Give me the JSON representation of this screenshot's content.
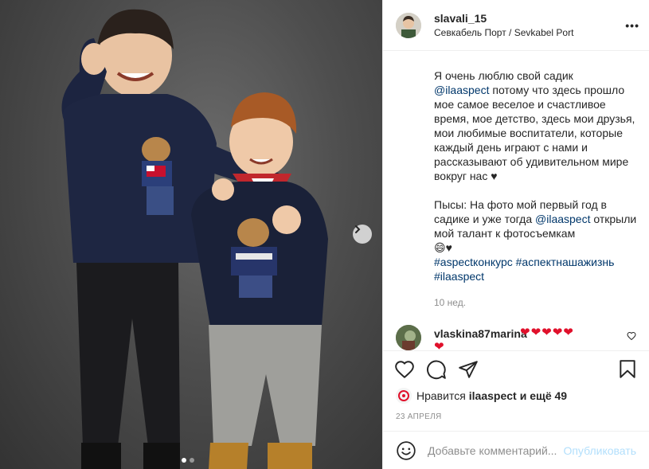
{
  "post": {
    "username": "slavali_15",
    "location": "Севкабель Порт / Sevkabel Port",
    "more_label": "•••"
  },
  "caption": {
    "line1": "Я очень люблю свой садик",
    "mention1": "@ilaaspect",
    "line2": " потому что здесь прошло мое самое веселое и счастливое время, мое детство, здесь мои друзья, мои любимые воспитатели, которые каждый день играют с нами и рассказывают об удивительном мире вокруг нас ♥",
    "line3": "Пысы: На фото мой первый год в садике и уже тогда ",
    "mention2": "@ilaaspect",
    "line4": " открыли мой талант к фотосъемкам",
    "emoji": "😄♥",
    "hashtag1": "#aspectконкурс",
    "hashtag2": "#аспектнашажизнь",
    "hashtag3": "#ilaaspect",
    "age": "10 нед."
  },
  "comment": {
    "username": "vlaskina87marina",
    "hearts": "❤❤❤❤❤",
    "hearts_wrap": "❤"
  },
  "likes": {
    "prefix": "Нравится",
    "user": "ilaaspect",
    "suffix": "и ещё 49"
  },
  "date": "23 АПРЕЛЯ",
  "add_comment": {
    "placeholder": "Добавьте комментарий...",
    "publish": "Опубликовать"
  },
  "carousel": {
    "slides": 2,
    "active": 1
  },
  "colors": {
    "link": "#00376b",
    "heart": "#e0102b",
    "publish": "#b2dffc"
  }
}
